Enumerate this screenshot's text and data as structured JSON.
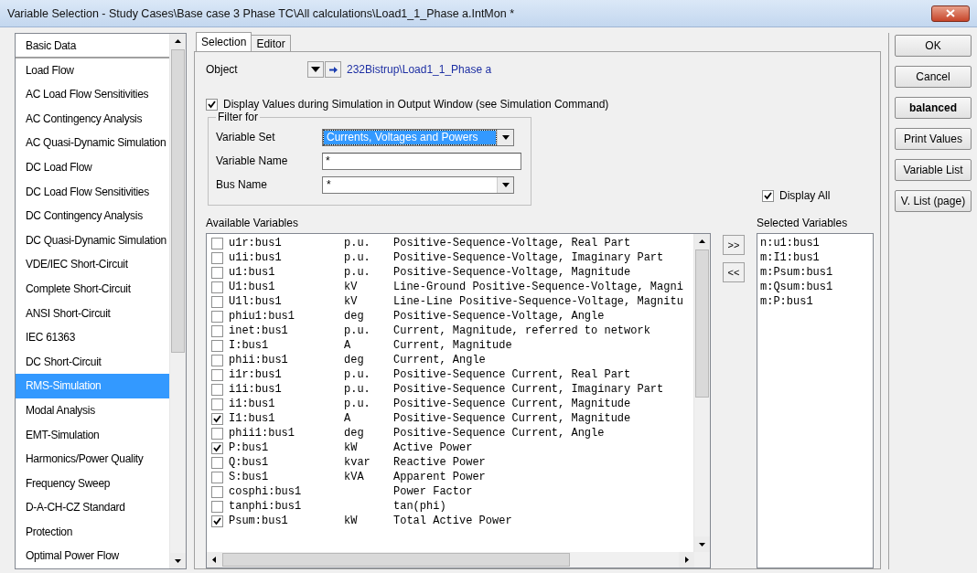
{
  "window": {
    "title": "Variable Selection - Study Cases\\Base case 3 Phase TC\\All calculations\\Load1_1_Phase a.IntMon *"
  },
  "sidebar": {
    "items": [
      {
        "label": "Basic Data",
        "selected": false
      },
      {
        "label": "Load Flow",
        "selected": false
      },
      {
        "label": "AC Load Flow Sensitivities",
        "selected": false
      },
      {
        "label": "AC Contingency Analysis",
        "selected": false
      },
      {
        "label": "AC Quasi-Dynamic Simulation",
        "selected": false
      },
      {
        "label": "DC Load Flow",
        "selected": false
      },
      {
        "label": "DC Load Flow Sensitivities",
        "selected": false
      },
      {
        "label": "DC Contingency Analysis",
        "selected": false
      },
      {
        "label": "DC Quasi-Dynamic Simulation",
        "selected": false
      },
      {
        "label": "VDE/IEC Short-Circuit",
        "selected": false
      },
      {
        "label": "Complete Short-Circuit",
        "selected": false
      },
      {
        "label": "ANSI Short-Circuit",
        "selected": false
      },
      {
        "label": "IEC 61363",
        "selected": false
      },
      {
        "label": "DC Short-Circuit",
        "selected": false
      },
      {
        "label": "RMS-Simulation",
        "selected": true
      },
      {
        "label": "Modal Analysis",
        "selected": false
      },
      {
        "label": "EMT-Simulation",
        "selected": false
      },
      {
        "label": "Harmonics/Power Quality",
        "selected": false
      },
      {
        "label": "Frequency Sweep",
        "selected": false
      },
      {
        "label": "D-A-CH-CZ Standard",
        "selected": false
      },
      {
        "label": "Protection",
        "selected": false
      },
      {
        "label": "Optimal Power Flow",
        "selected": false
      }
    ]
  },
  "tabs": [
    {
      "label": "Selection",
      "selected": true
    },
    {
      "label": "Editor",
      "selected": false
    }
  ],
  "object": {
    "label": "Object",
    "value": "232Bistrup\\Load1_1_Phase a"
  },
  "display_values": {
    "label": "Display Values during Simulation in Output Window (see Simulation Command)",
    "checked": true
  },
  "filter": {
    "title": "Filter for",
    "fields": [
      {
        "kind": "combo",
        "label": "Variable Set",
        "value": "Currents, Voltages and Powers",
        "highlighted": true
      },
      {
        "kind": "text",
        "label": "Variable Name",
        "value": "*"
      },
      {
        "kind": "combo",
        "label": "Bus Name",
        "value": "*",
        "highlighted": false
      }
    ]
  },
  "display_all": {
    "label": "Display All",
    "checked": true
  },
  "available_variables": {
    "label": "Available Variables",
    "rows": [
      {
        "name": "u1r:bus1",
        "unit": "p.u.",
        "description": "Positive-Sequence-Voltage, Real Part",
        "checked": false
      },
      {
        "name": "u1i:bus1",
        "unit": "p.u.",
        "description": "Positive-Sequence-Voltage, Imaginary Part",
        "checked": false
      },
      {
        "name": "u1:bus1",
        "unit": "p.u.",
        "description": "Positive-Sequence-Voltage, Magnitude",
        "checked": false
      },
      {
        "name": "U1:bus1",
        "unit": "kV",
        "description": "Line-Ground Positive-Sequence-Voltage, Magni",
        "checked": false
      },
      {
        "name": "U1l:bus1",
        "unit": "kV",
        "description": "Line-Line Positive-Sequence-Voltage, Magnitu",
        "checked": false
      },
      {
        "name": "phiu1:bus1",
        "unit": "deg",
        "description": "Positive-Sequence-Voltage, Angle",
        "checked": false
      },
      {
        "name": "inet:bus1",
        "unit": "p.u.",
        "description": "Current, Magnitude, referred to network",
        "checked": false
      },
      {
        "name": "I:bus1",
        "unit": "A",
        "description": "Current, Magnitude",
        "checked": false
      },
      {
        "name": "phii:bus1",
        "unit": "deg",
        "description": "Current, Angle",
        "checked": false
      },
      {
        "name": "i1r:bus1",
        "unit": "p.u.",
        "description": "Positive-Sequence Current, Real Part",
        "checked": false
      },
      {
        "name": "i1i:bus1",
        "unit": "p.u.",
        "description": "Positive-Sequence Current, Imaginary Part",
        "checked": false
      },
      {
        "name": "i1:bus1",
        "unit": "p.u.",
        "description": "Positive-Sequence Current, Magnitude",
        "checked": false
      },
      {
        "name": "I1:bus1",
        "unit": "A",
        "description": "Positive-Sequence Current, Magnitude",
        "checked": true
      },
      {
        "name": "phii1:bus1",
        "unit": "deg",
        "description": "Positive-Sequence Current, Angle",
        "checked": false
      },
      {
        "name": "P:bus1",
        "unit": "kW",
        "description": "Active Power",
        "checked": true
      },
      {
        "name": "Q:bus1",
        "unit": "kvar",
        "description": "Reactive Power",
        "checked": false
      },
      {
        "name": "S:bus1",
        "unit": "kVA",
        "description": "Apparent Power",
        "checked": false
      },
      {
        "name": "cosphi:bus1",
        "unit": "",
        "description": "Power Factor",
        "checked": false
      },
      {
        "name": "tanphi:bus1",
        "unit": "",
        "description": "tan(phi)",
        "checked": false
      },
      {
        "name": "Psum:bus1",
        "unit": "kW",
        "description": "Total Active Power",
        "checked": true
      }
    ]
  },
  "move_buttons": [
    ">>",
    "<<"
  ],
  "selected_variables": {
    "label": "Selected Variables",
    "items": [
      "n:u1:bus1",
      "m:I1:bus1",
      "m:Psum:bus1",
      "m:Qsum:bus1",
      "m:P:bus1"
    ]
  },
  "buttons": [
    {
      "label": "OK",
      "bold": false
    },
    {
      "label": "Cancel",
      "bold": false
    },
    {
      "label": "balanced",
      "bold": true
    },
    {
      "label": "Print Values",
      "bold": false
    },
    {
      "label": "Variable List",
      "bold": false
    },
    {
      "label": "V. List (page)",
      "bold": false
    }
  ]
}
